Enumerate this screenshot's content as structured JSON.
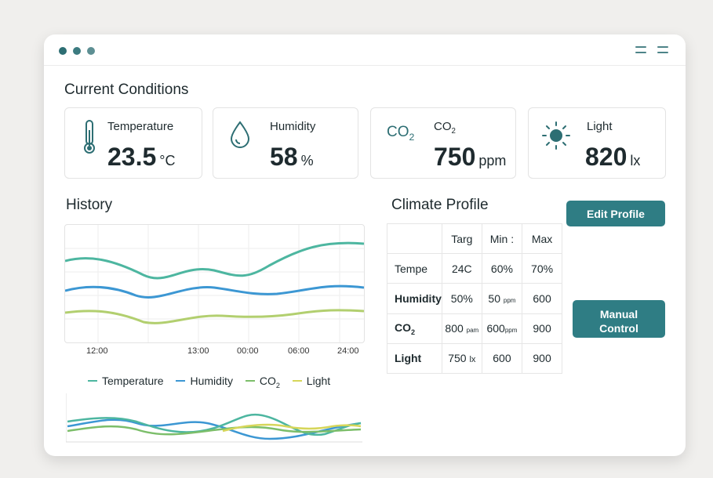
{
  "titlebar": {
    "traffic_lights": [
      "#2d6e73",
      "#3c7b80",
      "#5d8f93"
    ],
    "menu_icon": "hamburger-icon"
  },
  "current_conditions": {
    "title": "Current Conditions",
    "cards": [
      {
        "label": "Temperature",
        "value": "23.5",
        "unit": "°C",
        "icon": "thermometer-icon"
      },
      {
        "label": "Humidity",
        "value": "58",
        "unit": "%",
        "icon": "droplet-icon"
      },
      {
        "label": "CO",
        "label_sub": "2",
        "icon_text": "CO",
        "icon_text_sub": "2",
        "value": "750",
        "unit": "ppm",
        "icon": "co2-icon"
      },
      {
        "label": "Light",
        "value": "820",
        "unit": "lx",
        "icon": "sun-icon"
      }
    ]
  },
  "history": {
    "title": "History",
    "x_ticks": [
      "12:00",
      "13:00",
      "00:00",
      "06:00",
      "24:00"
    ],
    "legend": [
      {
        "name": "Temperature",
        "color": "#4db6a0"
      },
      {
        "name": "Humidity",
        "color": "#3c97d3"
      },
      {
        "name": "CO",
        "sub": "2",
        "color": "#7cbe6a"
      },
      {
        "name": "Light",
        "color": "#d6d65a"
      }
    ]
  },
  "climate_profile": {
    "title": "Climate Profile",
    "headers": [
      "",
      "Targ",
      "Min :",
      "Max"
    ],
    "rows": [
      {
        "label": "Tempe",
        "target": "24",
        "target_unit": "C",
        "min": "60%",
        "max": "70%"
      },
      {
        "label": "Humidity",
        "target": "50",
        "target_unit": "%",
        "min": "50",
        "min_unit": "ppm",
        "max": "600"
      },
      {
        "label": "CO",
        "label_sub": "2",
        "target": "800",
        "target_unit": "pam",
        "min": "600",
        "min_unit": "ppm",
        "max": "900"
      },
      {
        "label": "Light",
        "target": "750",
        "target_unit": "lx",
        "min": "600",
        "max": "900"
      }
    ]
  },
  "buttons": {
    "edit_profile": "Edit Profile",
    "manual_control_line1": "Manual",
    "manual_control_line2": "Control"
  },
  "colors": {
    "accent": "#2f7d84",
    "temperature": "#4db6a0",
    "humidity": "#3c97d3",
    "co2": "#7cbe6a",
    "light": "#d6d65a"
  }
}
